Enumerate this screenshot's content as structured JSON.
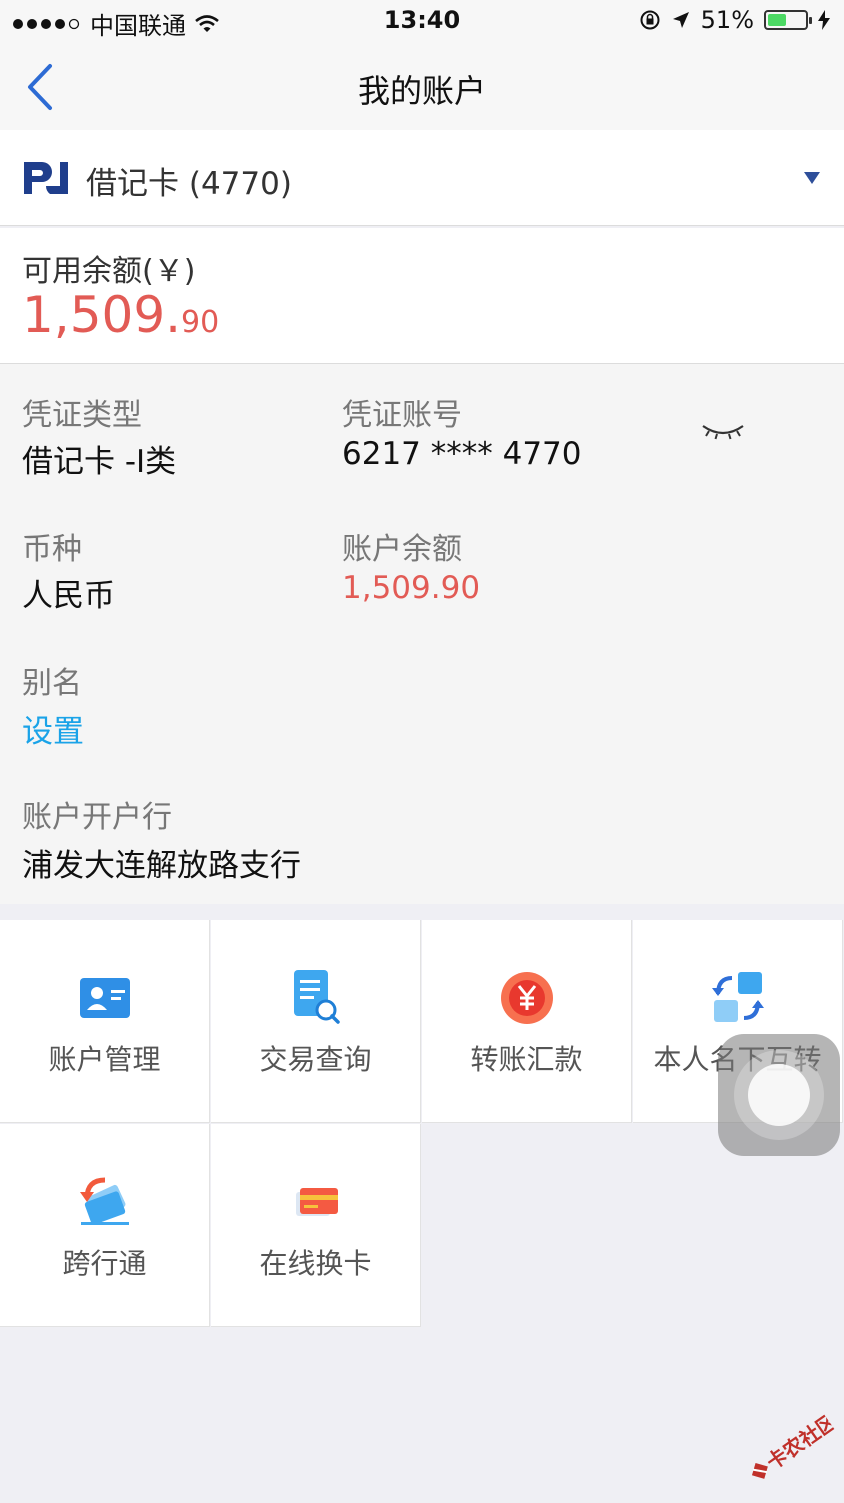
{
  "status_bar": {
    "carrier": "中国联通",
    "time": "13:40",
    "battery_pct": "51%",
    "battery_level": 0.51
  },
  "nav": {
    "title": "我的账户"
  },
  "card_selector": {
    "name": "借记卡 (4770)"
  },
  "balance": {
    "label": "可用余额(￥)",
    "integer": "1,509.",
    "decimal": "90"
  },
  "details": {
    "voucher_type": {
      "label": "凭证类型",
      "value": "借记卡 -I类"
    },
    "voucher_no": {
      "label": "凭证账号",
      "value": "6217 **** 4770"
    },
    "currency": {
      "label": "币种",
      "value": "人民币"
    },
    "account_balance": {
      "label": "账户余额",
      "value": "1,509.90"
    },
    "alias": {
      "label": "别名",
      "value": "设置"
    },
    "branch": {
      "label": "账户开户行",
      "value": "浦发大连解放路支行"
    }
  },
  "actions": [
    {
      "label": "账户管理",
      "icon": "account-card-icon"
    },
    {
      "label": "交易查询",
      "icon": "document-search-icon"
    },
    {
      "label": "转账汇款",
      "icon": "yuan-coin-icon"
    },
    {
      "label": "本人名下互转",
      "icon": "swap-arrows-icon"
    },
    {
      "label": "跨行通",
      "icon": "cards-arrow-icon"
    },
    {
      "label": "在线换卡",
      "icon": "bank-card-icon"
    }
  ],
  "colors": {
    "accent_red": "#e25b55",
    "link_blue": "#1aa3e8",
    "brand_blue": "#2e4f9a"
  }
}
